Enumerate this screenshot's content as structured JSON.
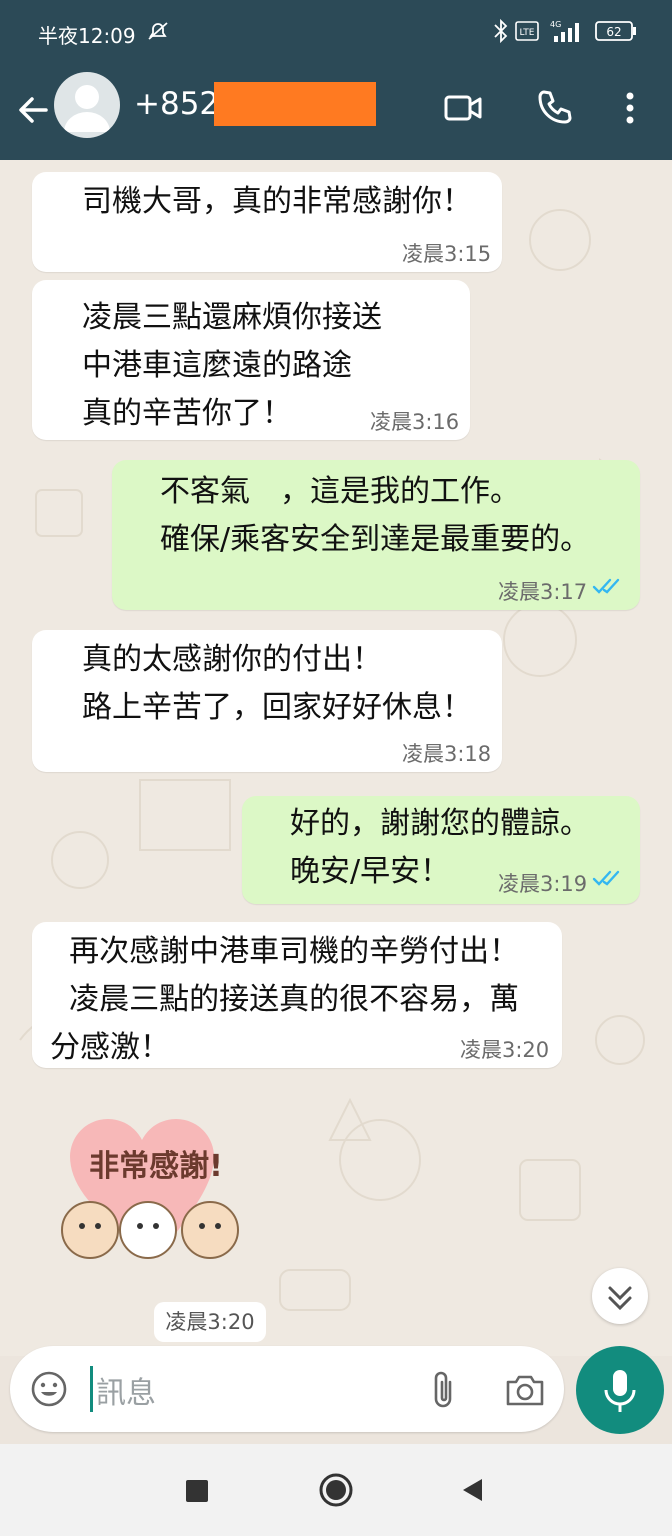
{
  "status_bar": {
    "time": "半夜12:09",
    "battery": "62",
    "network": "4G"
  },
  "header": {
    "phone_prefix": "+852"
  },
  "messages": [
    {
      "direction": "in",
      "text": "司機大哥，真的非常感謝你！",
      "time": "凌晨3:15"
    },
    {
      "direction": "in",
      "text": "凌晨三點還麻煩你接送\n中港車這麼遠的路途\n真的辛苦你了！",
      "time": "凌晨3:16"
    },
    {
      "direction": "out",
      "text": "不客氣　，這是我的工作。\n確保/乘客安全到達是最重要的。",
      "time": "凌晨3:17"
    },
    {
      "direction": "in",
      "text": "真的太感謝你的付出！\n路上辛苦了，回家好好休息！",
      "time": "凌晨3:18"
    },
    {
      "direction": "out",
      "text": "好的，謝謝您的體諒。\n晚安/早安！",
      "time": "凌晨3:19"
    },
    {
      "direction": "in",
      "text": "  再次感謝中港車司機的辛勞付出！\n  凌晨三點的接送真的很不容易，萬\n分感激！",
      "time": "凌晨3:20"
    }
  ],
  "sticker": {
    "text": "非常感謝!",
    "time": "凌晨3:20"
  },
  "composer": {
    "placeholder": "訊息"
  },
  "colors": {
    "header_bg": "#2c4a57",
    "incoming_bubble": "#ffffff",
    "outgoing_bubble": "#dcf8c6",
    "read_ticks": "#34b7f1",
    "mic_button": "#128c7e",
    "redaction": "#ff7a21"
  },
  "icons": [
    "back-arrow-icon",
    "avatar-icon",
    "video-call-icon",
    "phone-call-icon",
    "more-vert-icon",
    "emoji-icon",
    "attach-icon",
    "camera-icon",
    "mic-icon",
    "scroll-down-icon",
    "square-nav-icon",
    "home-nav-icon",
    "back-nav-icon"
  ]
}
